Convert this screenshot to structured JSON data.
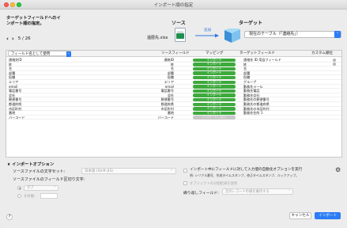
{
  "window": {
    "title": "インポート順の指定"
  },
  "header": {
    "heading": "ターゲットフィールドへのインポート順の指定。",
    "nav": {
      "prev": "‹",
      "next": "›",
      "page": "5 / 26"
    },
    "source_label": "ソース",
    "target_label": "ターゲット",
    "source_file": "還暦先.xlsx",
    "import_link": "追加",
    "target_table": "現在のテーブル（「連絡先」）",
    "target_chevron": "⌃"
  },
  "table": {
    "source_select": "フィールド名として使用",
    "headers": {
      "source_field": "ソースフィールド",
      "mapping": "マッピング",
      "target_field": "ターゲットフィールド",
      "custom": "カスタム順位"
    },
    "rows": [
      {
        "c1": "連絡先ID",
        "c2": "連絡ID",
        "mapping": "インポート",
        "target": "連絡先 ID 用自フィールド",
        "circle": true
      },
      {
        "c1": "姓",
        "c2": "姓",
        "mapping": "インポート",
        "target": "姓",
        "circle": true
      },
      {
        "c1": "名",
        "c2": "名",
        "mapping": "インポート",
        "target": "名",
        "circle": false
      },
      {
        "c1": "部署",
        "c2": "部署",
        "mapping": "インポート",
        "target": "部署",
        "circle": false
      },
      {
        "c1": "役職",
        "c2": "役職",
        "mapping": "インポート",
        "target": "役職",
        "circle": false
      },
      {
        "c1": "エリア",
        "c2": "エリア",
        "mapping": "インポート",
        "target": "グループ",
        "circle": false
      },
      {
        "c1": "email",
        "c2": "email",
        "mapping": "インポート",
        "target": "勤務先メール",
        "circle": false
      },
      {
        "c1": "電話番号",
        "c2": "電話番号",
        "mapping": "インポート",
        "target": "勤務先電話",
        "circle": false
      },
      {
        "c1": "会社",
        "c2": "会社",
        "mapping": "インポート",
        "target": "勤務先会社",
        "circle": false
      },
      {
        "c1": "郵便番号",
        "c2": "郵便番号",
        "mapping": "インポート",
        "target": "勤務先の郵便番号",
        "circle": false
      },
      {
        "c1": "都道府県",
        "c2": "都道府県",
        "mapping": "インポート",
        "target": "勤務先の都道府県",
        "circle": false
      },
      {
        "c1": "市区町村",
        "c2": "市区町村",
        "mapping": "インポート",
        "target": "勤務先の市区町村",
        "circle": false
      },
      {
        "c1": "番地",
        "c2": "番地",
        "mapping": "インポート",
        "target": "勤務先住所 1",
        "circle": false
      },
      {
        "c1": "バーコード",
        "c2": "バーコード",
        "mapping": "インポートしない",
        "target": "",
        "circle": false,
        "off": true
      }
    ]
  },
  "options": {
    "title": "∨ インポートオプション",
    "charset_label": "ソースファイルの文字セット:",
    "charset_value": "日本語 (Shift-JIS)",
    "delimiter_label": "ソースファイルのフィールド区切り文字:",
    "delimiter_tab": "タブ",
    "delimiter_other": "その他:",
    "auto_enter_label": "インポート中にフィールドに対して入力値の自動化オプションを実行",
    "auto_enter_sub": "例: シリアル番号、作成タイムスタンプ、修正タイムスタンプ、ルックアップ。",
    "split_label": "オブジェクトの分割結果を使用",
    "repeat_label": "繰り返しフィールド:",
    "repeat_value": "元のレコードの値を維持する"
  },
  "footer": {
    "help": "?",
    "cancel": "キャンセル",
    "import": "インポート"
  },
  "colors": {
    "accent": "#2b7cf6",
    "import_pill": "#3daa3c"
  }
}
